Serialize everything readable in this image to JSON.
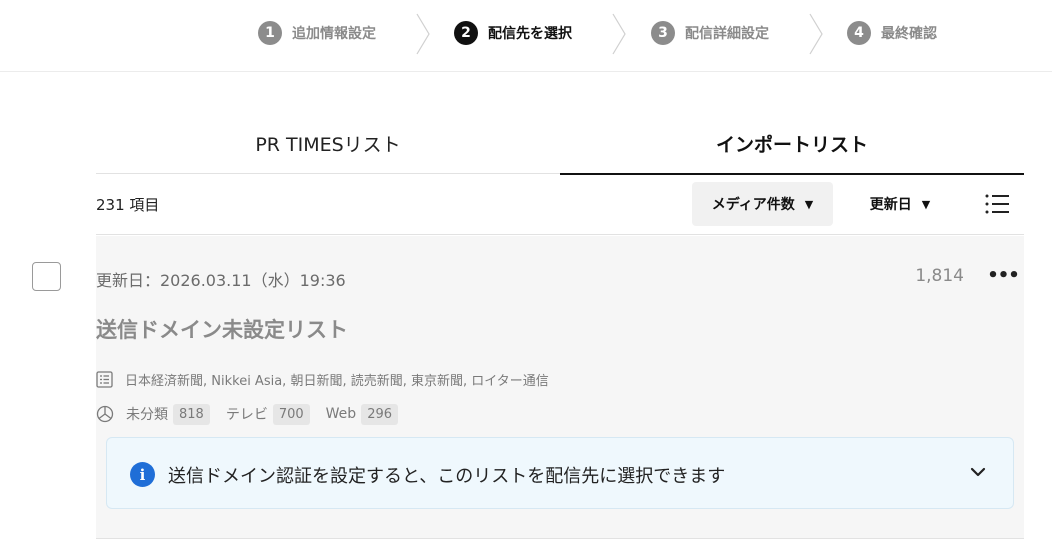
{
  "stepper": {
    "steps": [
      {
        "num": "1",
        "label": "追加情報設定"
      },
      {
        "num": "2",
        "label": "配信先を選択"
      },
      {
        "num": "3",
        "label": "配信詳細設定"
      },
      {
        "num": "4",
        "label": "最終確認"
      }
    ],
    "active_index": 1
  },
  "tabs": [
    {
      "label": "PR TIMESリスト"
    },
    {
      "label": "インポートリスト"
    }
  ],
  "active_tab": 1,
  "toolbar": {
    "count": "231 項目",
    "sort_media_label": "メディア件数",
    "sort_date_label": "更新日",
    "caret": "▼"
  },
  "list_item": {
    "updated": "更新日：2026.03.11（水）19:36",
    "media_count": "1,814",
    "more": "•••",
    "title": "送信ドメイン未設定リスト",
    "media": "日本経済新聞, Nikkei Asia, 朝日新聞, 読売新聞, 東京新聞, ロイター通信",
    "categories": [
      {
        "label": "未分類",
        "count": "818"
      },
      {
        "label": "テレビ",
        "count": "700"
      },
      {
        "label": "Web",
        "count": "296"
      }
    ],
    "notice": {
      "icon": "i",
      "text": "送信ドメイン認証を設定すると、このリストを配信先に選択できます"
    }
  },
  "icons": {
    "list_view": "list-view-icon",
    "media_list": "list-doc-icon",
    "pie": "pie-chart-icon",
    "info": "info-icon",
    "chevron": "chevron-down-icon"
  },
  "colors": {
    "accent": "#1f6ed7",
    "active": "#111111",
    "inactive": "#8c8c8c",
    "notice_bg": "#eff8fd"
  }
}
